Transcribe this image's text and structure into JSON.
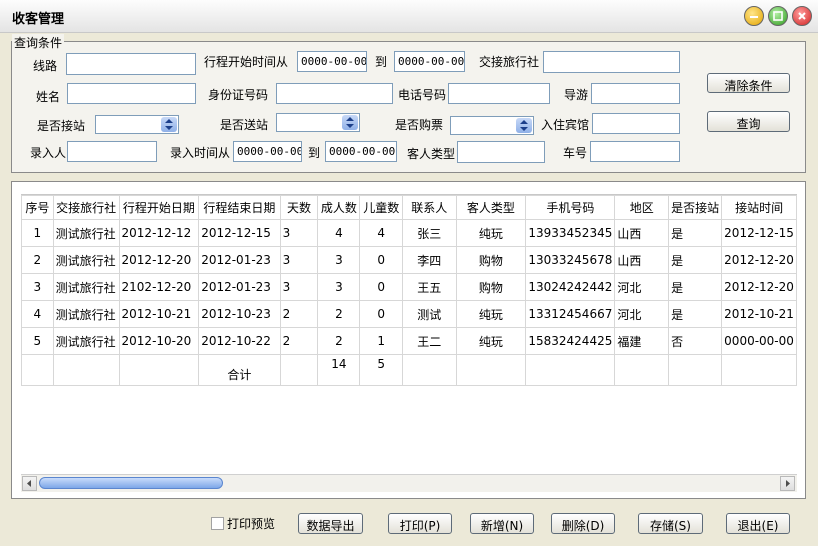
{
  "window": {
    "title": "收客管理"
  },
  "query": {
    "legend": "查询条件",
    "line_label": "线路",
    "start_label": "行程开始时间从",
    "start_from": "0000-00-00",
    "to_label": "到",
    "start_to": "0000-00-00",
    "agency_label": "交接旅行社",
    "name_label": "姓名",
    "idcard_label": "身份证号码",
    "phone_label": "电话号码",
    "guide_label": "导游",
    "pickup_label": "是否接站",
    "dropoff_label": "是否送站",
    "ticket_label": "是否购票",
    "hotel_label": "入住宾馆",
    "recorder_label": "录入人",
    "record_time_label": "录入时间从",
    "record_from": "0000-00-00",
    "record_to_label": "到",
    "record_to": "0000-00-00",
    "customer_type_label": "客人类型",
    "car_label": "车号",
    "clear_button": "清除条件",
    "search_button": "查询"
  },
  "table": {
    "columns": [
      "序号",
      "交接旅行社",
      "行程开始日期",
      "行程结束日期",
      "天数",
      "成人数",
      "儿童数",
      "联系人",
      "客人类型",
      "手机号码",
      "地区",
      "是否接站",
      "接站时间"
    ],
    "rows": [
      [
        "1",
        "测试旅行社",
        "2012-12-12",
        "2012-12-15",
        "3",
        "4",
        "4",
        "张三",
        "纯玩",
        "13933452345",
        "山西",
        "是",
        "2012-12-15"
      ],
      [
        "2",
        "测试旅行社",
        "2012-12-20",
        "2012-01-23",
        "3",
        "3",
        "0",
        "李四",
        "购物",
        "13033245678",
        "山西",
        "是",
        "2012-12-20"
      ],
      [
        "3",
        "测试旅行社",
        "2102-12-20",
        "2012-01-23",
        "3",
        "3",
        "0",
        "王五",
        "购物",
        "13024242442",
        "河北",
        "是",
        "2012-12-20"
      ],
      [
        "4",
        "测试旅行社",
        "2012-10-21",
        "2012-10-23",
        "2",
        "2",
        "0",
        "测试",
        "纯玩",
        "13312454667",
        "河北",
        "是",
        "2012-10-21"
      ],
      [
        "5",
        "测试旅行社",
        "2012-10-20",
        "2012-10-22",
        "2",
        "2",
        "1",
        "王二",
        "纯玩",
        "15832424425",
        "福建",
        "否",
        "0000-00-00"
      ]
    ],
    "total_label": "合计",
    "total_adults": "14",
    "total_children": "5"
  },
  "footer": {
    "print_preview": "打印预览",
    "export": "数据导出",
    "print": "打印(P)",
    "add": "新增(N)",
    "delete": "删除(D)",
    "save": "存储(S)",
    "exit": "退出(E)"
  },
  "colors": {
    "accent": "#7da7e8",
    "window_bg": "#ece9d8",
    "close": "#d12020",
    "maximize": "#2f9a1e",
    "minimize": "#e3a400"
  }
}
